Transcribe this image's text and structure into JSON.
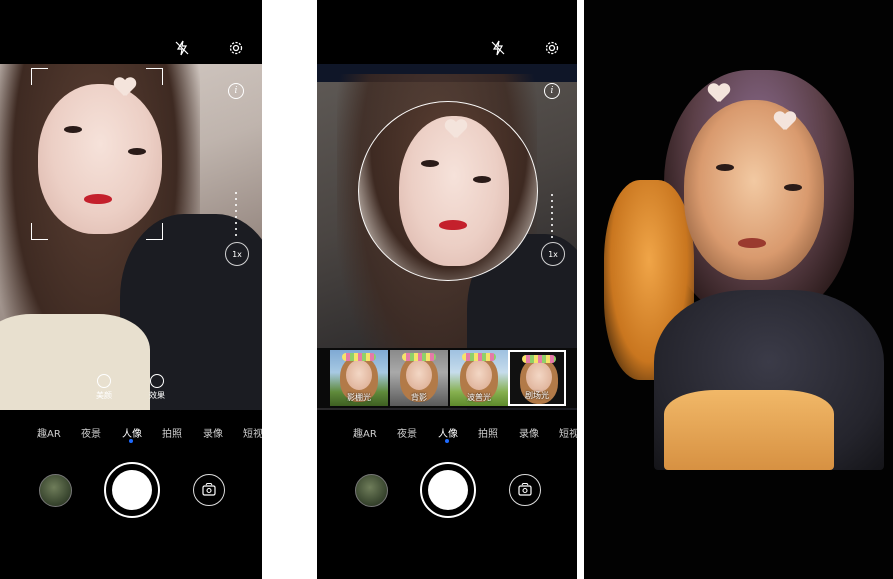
{
  "screens": [
    {
      "modes": [
        "趣AR",
        "夜景",
        "人像",
        "拍照",
        "录像",
        "短视"
      ],
      "active_mode": "人像",
      "zoom": "1x",
      "info": "i",
      "quick_actions": [
        "美颜",
        "效果"
      ]
    },
    {
      "modes": [
        "趣AR",
        "夜景",
        "人像",
        "拍照",
        "录像",
        "短视"
      ],
      "active_mode": "人像",
      "zoom": "1x",
      "info": "i",
      "filters": [
        {
          "label": "影棚光",
          "selected": false
        },
        {
          "label": "背影",
          "selected": false
        },
        {
          "label": "波普光",
          "selected": false
        },
        {
          "label": "剧场光",
          "selected": true
        }
      ]
    }
  ],
  "colors": {
    "accent": "#1f6bff",
    "background": "#000000"
  },
  "icons": [
    "flash-off-icon",
    "settings-gear-icon",
    "info-icon",
    "beauty-icon",
    "effect-icon",
    "gallery-thumbnail",
    "shutter-button",
    "camera-switch-icon"
  ]
}
